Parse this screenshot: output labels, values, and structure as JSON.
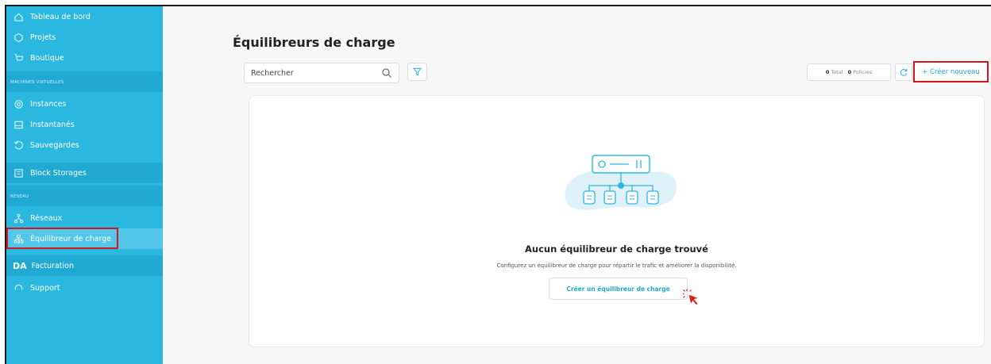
{
  "sidebar": {
    "items": [
      {
        "label": "Tableau de bord",
        "icon": "home-icon"
      },
      {
        "label": "Projets",
        "icon": "projects-icon"
      },
      {
        "label": "Boutique",
        "icon": "shop-icon"
      },
      {
        "label": "Instances",
        "icon": "instances-icon"
      },
      {
        "label": "Instantanés",
        "icon": "snapshot-icon"
      },
      {
        "label": "Sauvegardes",
        "icon": "backup-icon"
      },
      {
        "label": "Block Storages",
        "icon": "storage-icon"
      },
      {
        "label": "Réseaux",
        "icon": "network-icon"
      },
      {
        "label": "Équilibreur de charge",
        "icon": "load-balancer-icon"
      },
      {
        "label": "Facturation",
        "icon": "billing-icon",
        "prefix": "DA"
      },
      {
        "label": "Support",
        "icon": "support-icon"
      }
    ],
    "sections": {
      "vm": "MACHINES VIRTUELLES",
      "network": "RÉSEAU"
    }
  },
  "main": {
    "title": "Équilibreurs de charge",
    "search_placeholder": "Rechercher",
    "counts": {
      "total_value": "0",
      "total_label": "Total",
      "policies_value": "0",
      "policies_label": "Policies"
    },
    "create_label": "+ Créer nouveau",
    "empty": {
      "title": "Aucun équilibreur de charge trouvé",
      "description": "Configurez un équilibreur de charge pour répartir le trafic et améliorer la disponibilité.",
      "cta": "Créer un équilibreur de charge"
    }
  },
  "colors": {
    "accent": "#2bb8e0",
    "highlight": "#d7141b"
  }
}
